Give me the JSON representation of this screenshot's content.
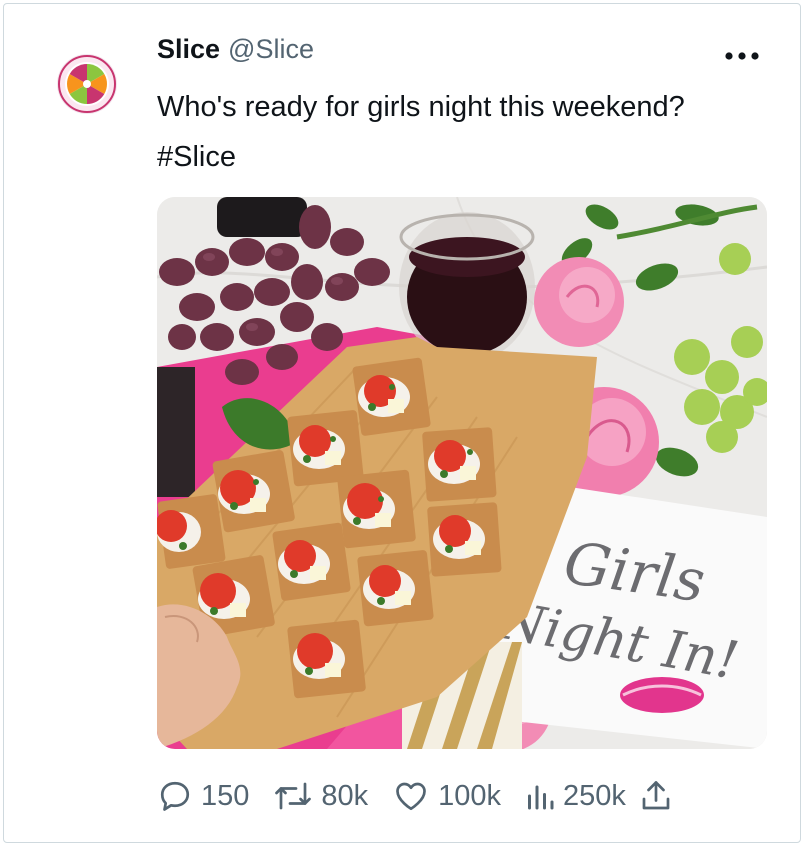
{
  "tweet": {
    "display_name": "Slice",
    "handle": "@Slice",
    "text": "Who's ready for girls night this weekend? #Slice",
    "more_icon": "more-horizontal-icon",
    "avatar_icon": "citrus-slice-logo"
  },
  "media": {
    "sign_line_1": "Girls",
    "sign_line_2": "Night In!",
    "colors": {
      "board": "#d9a866",
      "cloth": "#ea3d8f",
      "grape": "#6d3346",
      "rose": "#f28cb5",
      "lime": "#9fcc4c"
    }
  },
  "actions": {
    "reply_count": "150",
    "retweet_count": "80k",
    "like_count": "100k",
    "views_count": "250k",
    "icons": [
      "reply-icon",
      "retweet-icon",
      "heart-icon",
      "views-icon",
      "share-icon"
    ]
  }
}
